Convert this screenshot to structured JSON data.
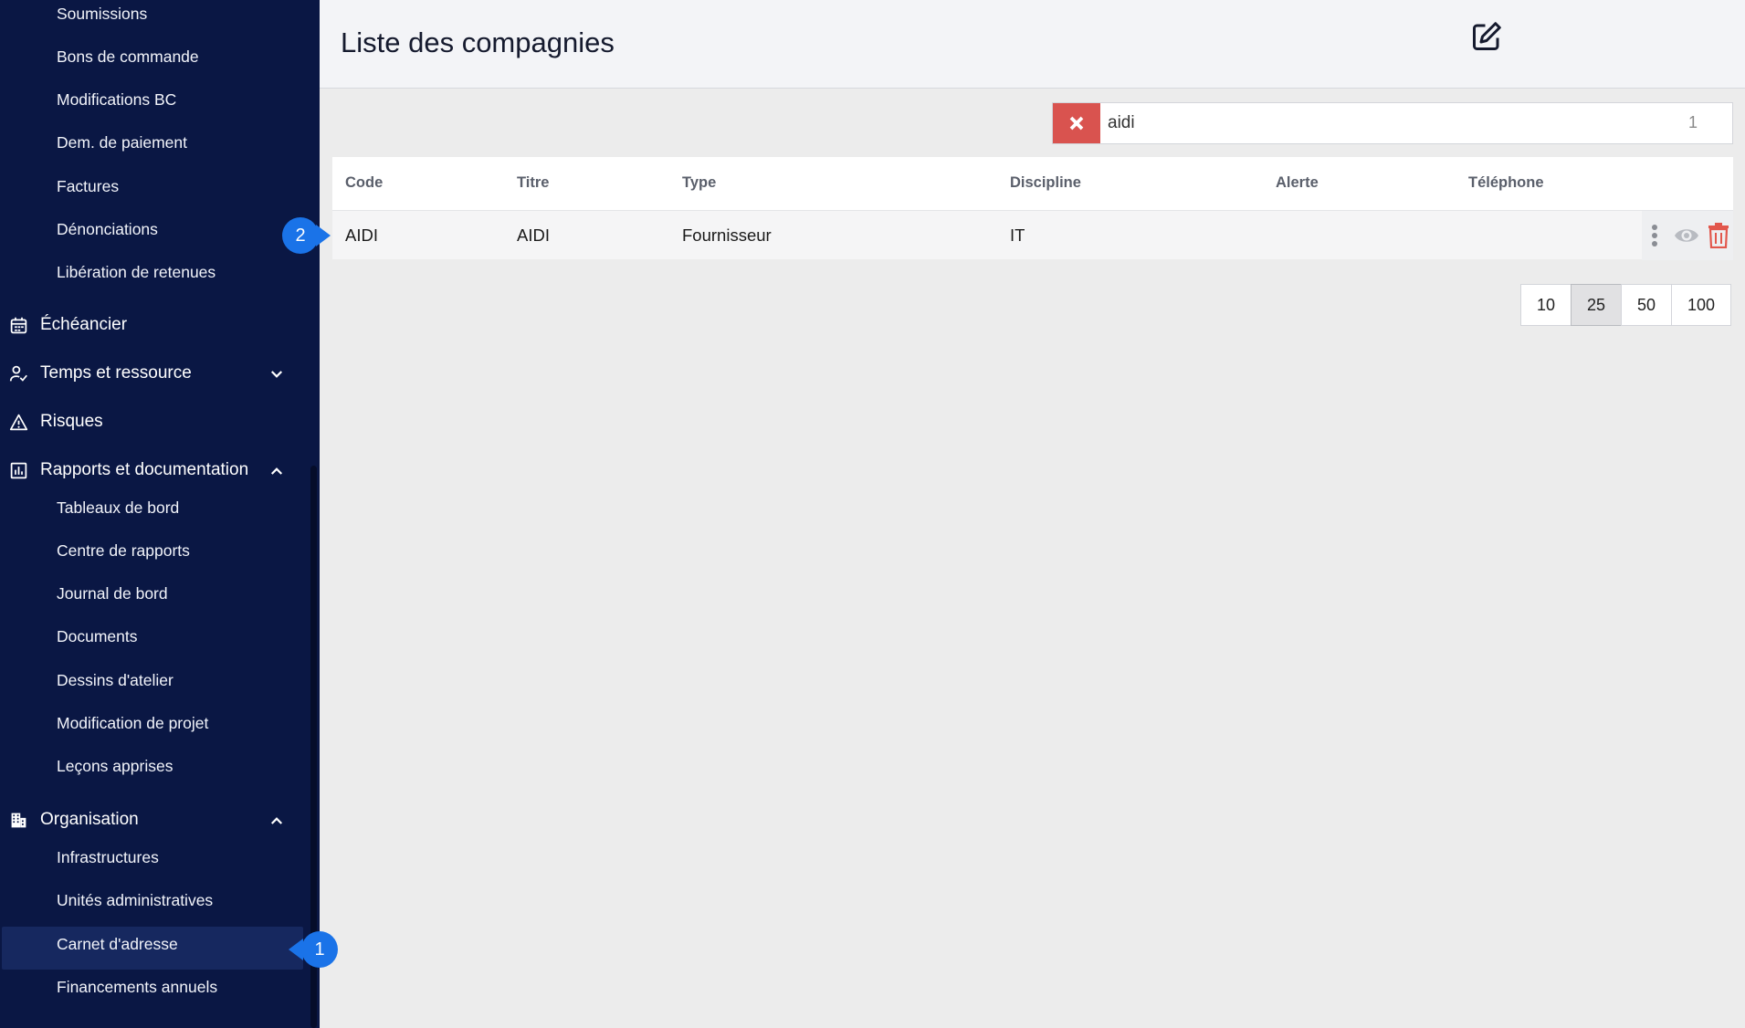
{
  "sidebar": {
    "sub_top": [
      {
        "label": "Soumissions"
      },
      {
        "label": "Bons de commande"
      },
      {
        "label": "Modifications BC"
      },
      {
        "label": "Dem. de paiement"
      },
      {
        "label": "Factures"
      },
      {
        "label": "Dénonciations"
      },
      {
        "label": "Libération de retenues"
      }
    ],
    "main": [
      {
        "label": "Échéancier",
        "icon": "calendar-icon"
      },
      {
        "label": "Temps et ressource",
        "icon": "user-check-icon",
        "chevron": "down"
      },
      {
        "label": "Risques",
        "icon": "warning-icon"
      },
      {
        "label": "Rapports et documentation",
        "icon": "report-icon",
        "chevron": "up"
      }
    ],
    "reports_sub": [
      {
        "label": "Tableaux de bord"
      },
      {
        "label": "Centre de rapports"
      },
      {
        "label": "Journal de bord"
      },
      {
        "label": "Documents"
      },
      {
        "label": "Dessins d'atelier"
      },
      {
        "label": "Modification de projet"
      },
      {
        "label": "Leçons apprises"
      }
    ],
    "organisation": {
      "label": "Organisation",
      "icon": "building-icon",
      "chevron": "up"
    },
    "org_sub": [
      {
        "label": "Infrastructures"
      },
      {
        "label": "Unités administratives"
      },
      {
        "label": "Carnet d'adresse",
        "active": true
      },
      {
        "label": "Financements annuels"
      }
    ]
  },
  "header": {
    "title": "Liste des compagnies"
  },
  "search": {
    "value": "aidi",
    "count": "1"
  },
  "table": {
    "columns": [
      "Code",
      "Titre",
      "Type",
      "Discipline",
      "Alerte",
      "Téléphone"
    ],
    "rows": [
      {
        "code": "AIDI",
        "titre": "AIDI",
        "type": "Fournisseur",
        "discipline": "IT",
        "alerte": "",
        "telephone": ""
      }
    ]
  },
  "pagination": {
    "options": [
      "10",
      "25",
      "50",
      "100"
    ],
    "selected": "25"
  },
  "callouts": [
    "1",
    "2"
  ],
  "colors": {
    "sidebar_bg": "#0a1744",
    "accent": "#1a73e8",
    "danger": "#d9534f"
  }
}
